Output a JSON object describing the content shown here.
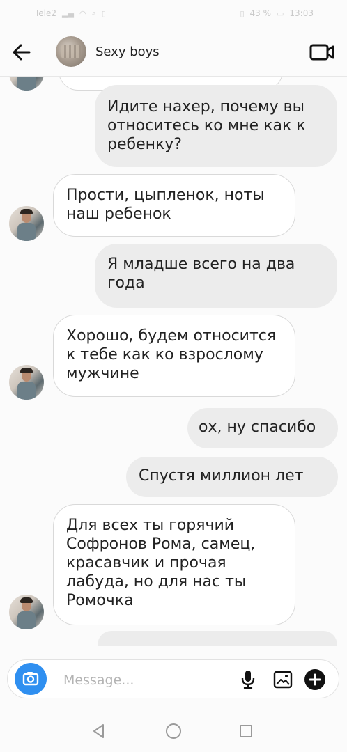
{
  "status_bar": {
    "carrier": "Tele2",
    "battery_percent": "43 %",
    "time": "13:03"
  },
  "header": {
    "title": "Sexy boys"
  },
  "messages": [
    {
      "side": "out",
      "text": "Идите нахер, почему вы относитесь ко мне как к ребенку?"
    },
    {
      "side": "in",
      "text": "Прости, цыпленок, ноты наш ребенок"
    },
    {
      "side": "out",
      "text": "Я младше всего на два года"
    },
    {
      "side": "in",
      "text": "Хорошо, будем относится к тебе как ко взрослому мужчине"
    },
    {
      "side": "out",
      "text": "ох, ну спасибо"
    },
    {
      "side": "out",
      "text": "Спустя миллион лет"
    },
    {
      "side": "in",
      "text": "Для всех ты горячий Софронов Рома, самец, красавчик и прочая лабуда, но для нас ты Ромочка"
    }
  ],
  "composer": {
    "placeholder": "Message..."
  },
  "icons": {
    "back": "arrow-left-icon",
    "video": "video-camera-icon",
    "camera": "camera-icon",
    "mic": "microphone-icon",
    "gallery": "image-icon",
    "more": "plus-icon"
  },
  "colors": {
    "accent": "#2f8ff0",
    "outgoing_bubble": "#ececec",
    "incoming_bubble": "#ffffff"
  }
}
